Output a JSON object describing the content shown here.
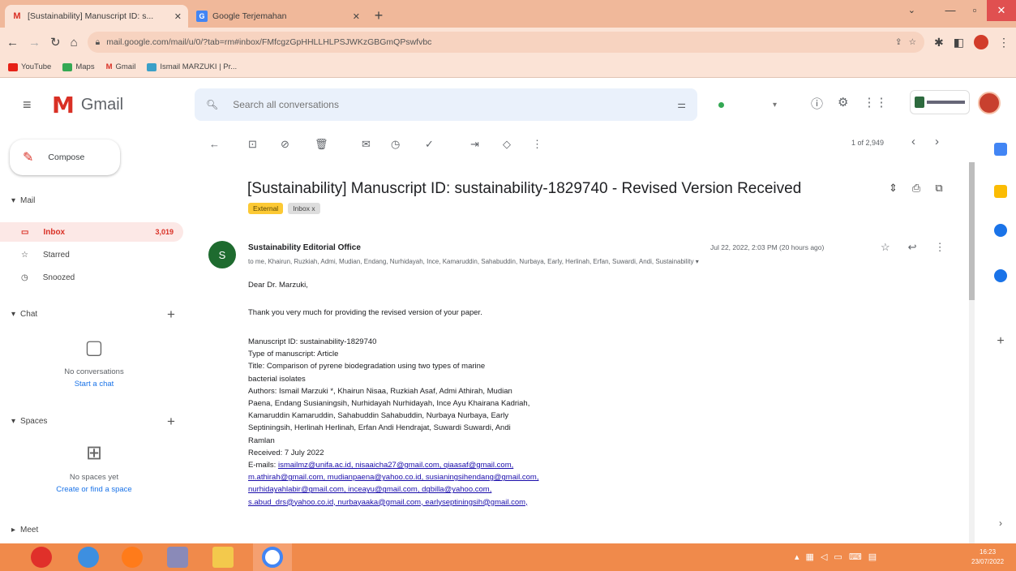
{
  "browser": {
    "tabs": [
      {
        "icon": "M",
        "title": "[Sustainability] Manuscript ID: s..."
      },
      {
        "icon": "G",
        "title": "Google Terjemahan"
      }
    ],
    "url": "mail.google.com/mail/u/0/?tab=rm#inbox/FMfcgzGpHHLLHLPSJWKzGBGmQPswfvbc",
    "bookmarks": [
      "YouTube",
      "Maps",
      "Gmail",
      "Ismail MARZUKI | Pr..."
    ]
  },
  "gmail": {
    "app_name": "Gmail",
    "search_placeholder": "Search all conversations",
    "compose_label": "Compose",
    "sections": {
      "mail": "Mail",
      "chat": "Chat",
      "spaces": "Spaces",
      "meet": "Meet"
    },
    "nav_items": [
      {
        "label": "Inbox",
        "count": "3,019"
      },
      {
        "label": "Starred",
        "count": ""
      },
      {
        "label": "Snoozed",
        "count": ""
      }
    ],
    "chat_empty": {
      "text": "No conversations",
      "link": "Start a chat"
    },
    "spaces_empty": {
      "text": "No spaces yet",
      "link": "Create or find a space"
    },
    "pager": "1 of 2,949"
  },
  "message": {
    "subject": "[Sustainability] Manuscript ID: sustainability-1829740 - Revised Version Received",
    "labels": [
      "External",
      "Inbox x"
    ],
    "sender_initial": "S",
    "sender": "Sustainability Editorial Office",
    "date": "Jul 22, 2022, 2:03 PM (20 hours ago)",
    "to": "to me, Khairun, Ruzkiah, Admi, Mudian, Endang, Nurhidayah, Ince, Kamaruddin, Sahabuddin, Nurbaya, Early, Herlinah, Erfan, Suwardi, Andi, Sustainability",
    "greeting": "Dear Dr. Marzuki,",
    "intro": "Thank you very much for providing the revised version of your paper.",
    "details": [
      "Manuscript ID: sustainability-1829740",
      "Type of manuscript: Article",
      "Title: Comparison of pyrene biodegradation using two types of marine",
      "bacterial isolates",
      "Authors: Ismail Marzuki *, Khairun Nisaa, Ruzkiah Asaf, Admi Athirah, Mudian",
      "Paena, Endang Susianingsih, Nurhidayah Nurhidayah, Ince Ayu Khairana Kadriah,",
      "Kamaruddin Kamaruddin, Sahabuddin Sahabuddin, Nurbaya Nurbaya, Early",
      "Septiningsih, Herlinah Herlinah, Erfan Andi Hendrajat, Suwardi Suwardi, Andi",
      "Ramlan",
      "Received: 7 July 2022"
    ],
    "emails_label": "E-mails:",
    "email_lines": [
      "ismailmz@unifa.ac.id, nisaaicha27@gmail.com, qiaasaf@gmail.com,",
      "m.athirah@gmail.com, mudianpaena@yahoo.co.id, susianingsihendang@gmail.com,",
      "nurhidayahlabir@gmail.com, inceayu@gmail.com, dgbilla@yahoo.com,",
      "s.abud_drs@yahoo.co.id, nurbayaaka@gmail.com, earlyseptiningsih@gmail.com,"
    ]
  },
  "taskbar": {
    "time": "16:23",
    "date": "23/07/2022"
  }
}
